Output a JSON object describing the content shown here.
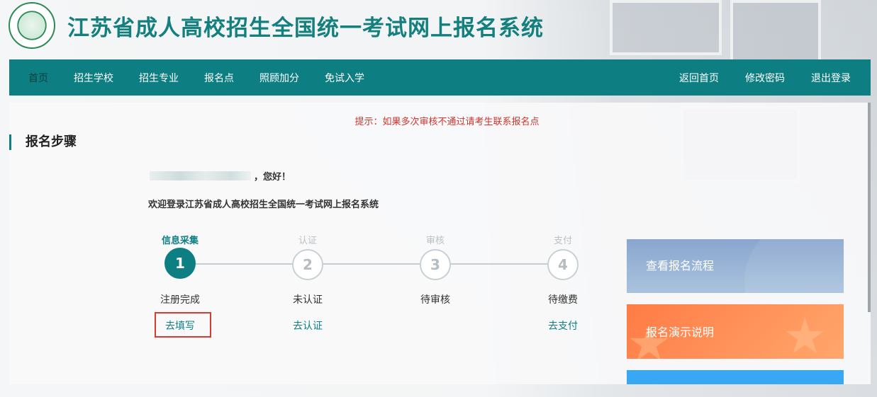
{
  "header": {
    "title": "江苏省成人高校招生全国统一考试网上报名系统"
  },
  "nav": {
    "left": [
      "首页",
      "招生学校",
      "招生专业",
      "报名点",
      "照顾加分",
      "免试入学"
    ],
    "right": [
      "返回首页",
      "修改密码",
      "退出登录"
    ]
  },
  "tip": "提示：如果多次审核不通过请考生联系报名点",
  "section_title": "报名步骤",
  "greeting_suffix": "，您好！",
  "welcome": "欢迎登录江苏省成人高校招生全国统一考试网上报名系统",
  "steps": [
    {
      "label": "信息采集",
      "num": "1",
      "status": "注册完成",
      "action": "去填写"
    },
    {
      "label": "认证",
      "num": "2",
      "status": "未认证",
      "action": "去认证"
    },
    {
      "label": "审核",
      "num": "3",
      "status": "待审核",
      "action": ""
    },
    {
      "label": "支付",
      "num": "4",
      "status": "待缴费",
      "action": "去支付"
    }
  ],
  "cards": [
    "查看报名流程",
    "报名演示说明"
  ],
  "colors": {
    "primary": "#0d7f83",
    "tip": "#d0342c",
    "highlight": "#d93a32"
  }
}
